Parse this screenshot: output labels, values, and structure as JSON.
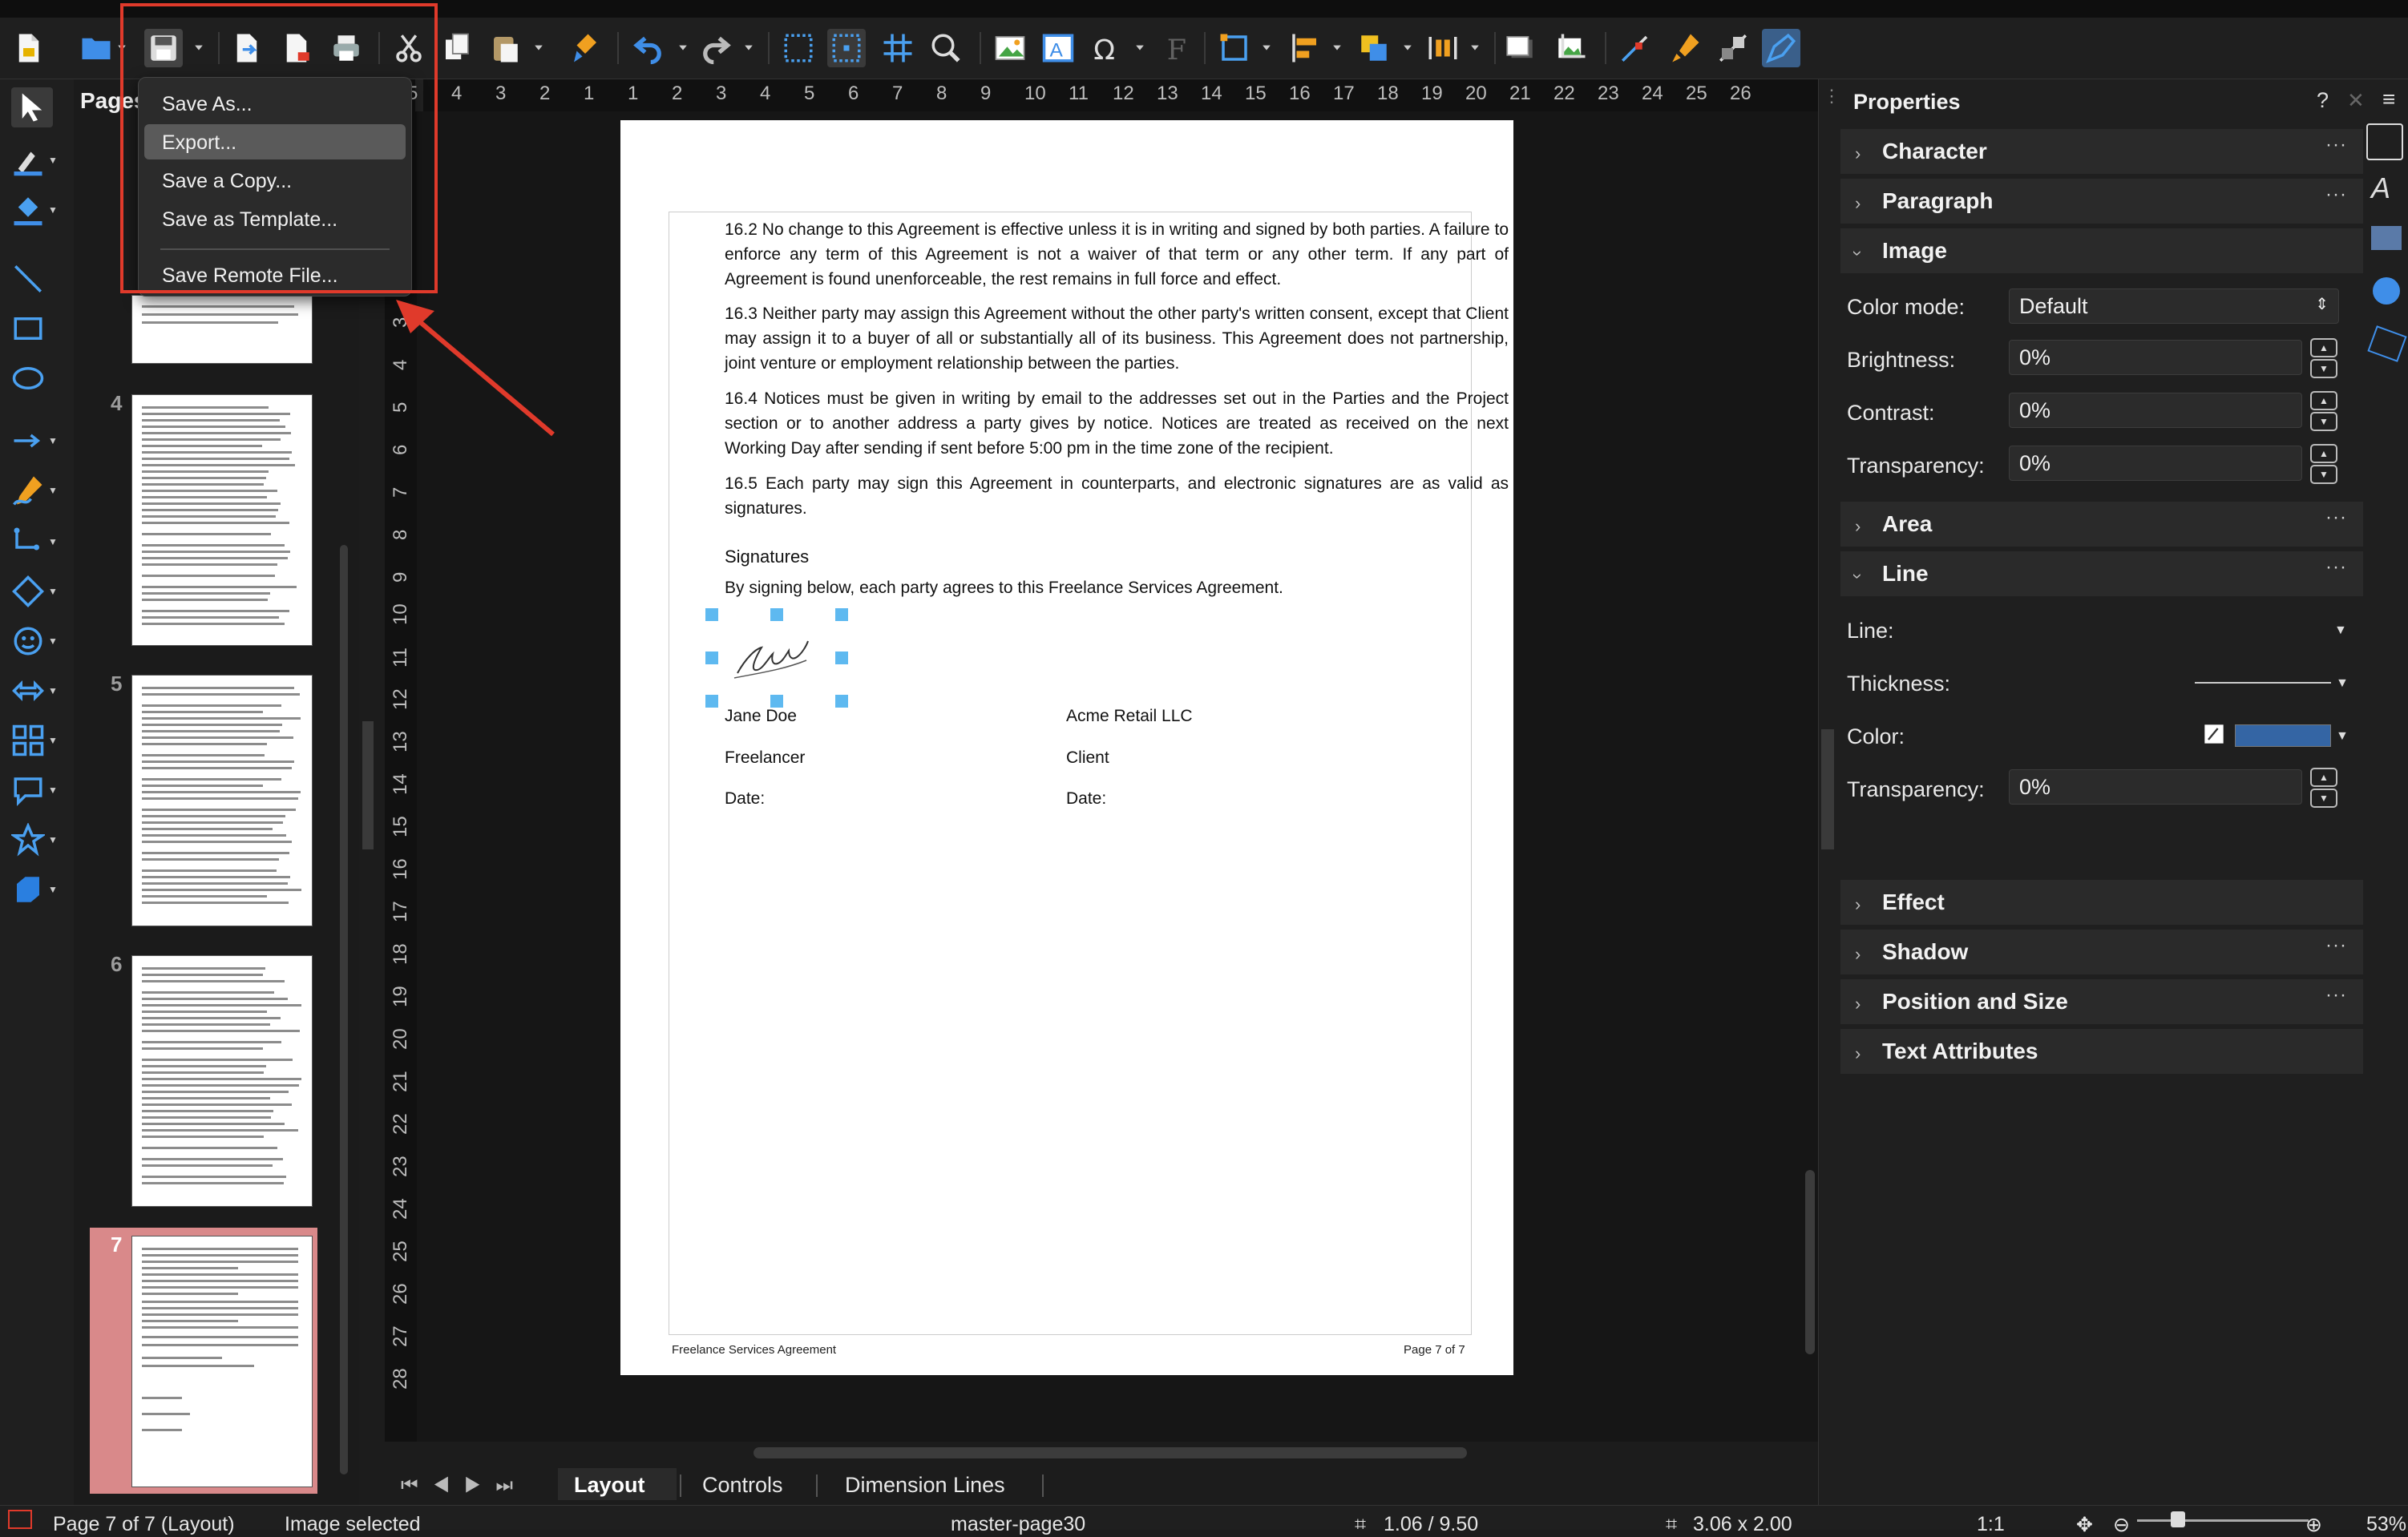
{
  "toolbar": {
    "icons": [
      "new-document",
      "open-folder",
      "save",
      "export-pdf",
      "export-directly",
      "print",
      "cut",
      "copy",
      "paste",
      "clone-formatting",
      "undo",
      "redo",
      "grid",
      "snap-guides",
      "helplines",
      "zoom-pan",
      "insert-image",
      "insert-textbox",
      "special-character",
      "fontwork",
      "transformations",
      "align",
      "arrange",
      "distribute",
      "shadow",
      "crop",
      "points",
      "glue-points",
      "toggle-extrusion",
      "show-draw-functions"
    ]
  },
  "save_menu": {
    "items": [
      "Save As...",
      "Export...",
      "Save a Copy...",
      "Save as Template...",
      "Save Remote File..."
    ],
    "highlighted": "Export...",
    "annotation_color": "#e03a2b"
  },
  "pages_pane": {
    "title": "Pages",
    "page_numbers": [
      "4",
      "5",
      "6",
      "7"
    ],
    "selected_page": "7",
    "selected_color": "#d9898a"
  },
  "rulers": {
    "horizontal": [
      "5",
      "4",
      "3",
      "2",
      "1",
      "1",
      "2",
      "3",
      "4",
      "5",
      "6",
      "7",
      "8",
      "9",
      "10",
      "11",
      "12",
      "13",
      "14",
      "15",
      "16",
      "17",
      "18",
      "19",
      "20",
      "21",
      "22",
      "23",
      "24",
      "25",
      "26"
    ],
    "vertical": [
      "3",
      "4",
      "5",
      "6",
      "7",
      "8",
      "9",
      "10",
      "11",
      "12",
      "13",
      "14",
      "15",
      "16",
      "17",
      "18",
      "19",
      "20",
      "21",
      "22",
      "23",
      "24",
      "25",
      "26",
      "27",
      "28"
    ]
  },
  "document": {
    "paragraphs": [
      "16.2 No change to this Agreement is effective unless it is in writing and signed by both parties. A failure to enforce any term of this Agreement is not a waiver of that term or any other term. If any part of Agreement is found unenforceable, the rest remains in full force and effect.",
      "16.3 Neither party may assign this Agreement without the other party's written consent, except that Client may assign it to a buyer of all or substantially all of its business. This Agreement does not partnership, joint venture or employment relationship between the parties.",
      "16.4 Notices must be given in writing by email to the addresses set out in the Parties and the Project section or to another address a party gives by notice. Notices are treated as received on the next Working Day after sending if sent before 5:00 pm in the time zone of the recipient.",
      "16.5 Each party may sign this Agreement in counterparts, and electronic signatures are as valid as signatures."
    ],
    "signatures_heading": "Signatures",
    "signatures_intro": "By signing below, each party agrees to this Freelance Services Agreement.",
    "party1_name": "Jane Doe",
    "party1_role": "Freelancer",
    "party1_date": "Date:",
    "party2_name": "Acme Retail LLC",
    "party2_role": "Client",
    "party2_date": "Date:",
    "footer_left": "Freelance Services Agreement",
    "footer_right": "Page 7 of 7",
    "selection_handle_color": "#5eb9f0"
  },
  "tabs": [
    "Layout",
    "Controls",
    "Dimension Lines"
  ],
  "active_tab": "Layout",
  "status": {
    "page": "Page 7 of 7 (Layout)",
    "selection": "Image selected",
    "master": "master-page30",
    "position": "1.06 / 9.50",
    "size": "3.06 x 2.00",
    "scale": "1:1",
    "zoom": "53%"
  },
  "sidebar": {
    "title": "Properties",
    "help": "?",
    "sections": {
      "character": "Character",
      "paragraph": "Paragraph",
      "image": "Image",
      "area": "Area",
      "line": "Line",
      "effect": "Effect",
      "shadow": "Shadow",
      "position_size": "Position and Size",
      "text_attributes": "Text Attributes"
    },
    "image": {
      "color_mode_label": "Color mode:",
      "color_mode_value": "Default",
      "brightness_label": "Brightness:",
      "brightness_value": "0%",
      "contrast_label": "Contrast:",
      "contrast_value": "0%",
      "transparency_label": "Transparency:",
      "transparency_value": "0%"
    },
    "line": {
      "line_label": "Line:",
      "thickness_label": "Thickness:",
      "color_label": "Color:",
      "color_value": "#3465a4",
      "transparency_label": "Transparency:",
      "transparency_value": "0%"
    }
  }
}
